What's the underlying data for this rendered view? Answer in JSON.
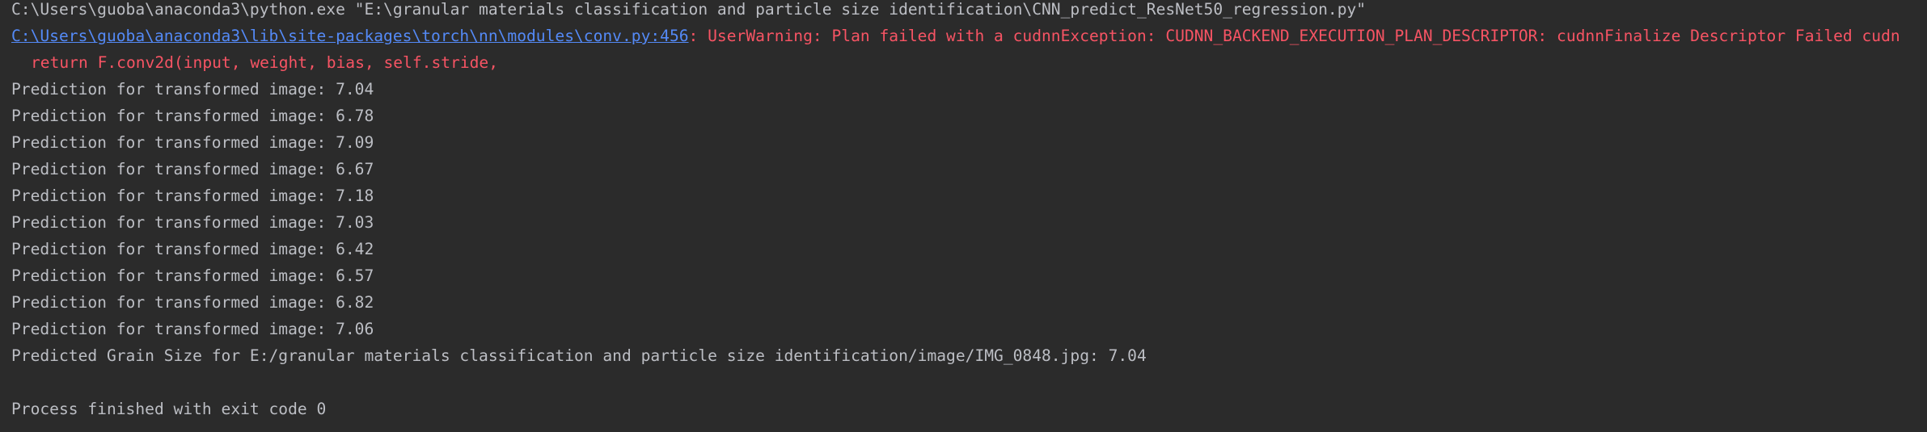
{
  "console": {
    "command": "C:\\Users\\guoba\\anaconda3\\python.exe \"E:\\granular materials classification and particle size identification\\CNN_predict_ResNet50_regression.py\"",
    "warning_link": "C:\\Users\\guoba\\anaconda3\\lib\\site-packages\\torch\\nn\\modules\\conv.py:456",
    "warning_message": ": UserWarning: Plan failed with a cudnnException: CUDNN_BACKEND_EXECUTION_PLAN_DESCRIPTOR: cudnnFinalize Descriptor Failed cudn",
    "warning_code": "return F.conv2d(input, weight, bias, self.stride,",
    "predictions": [
      "Prediction for transformed image: 7.04",
      "Prediction for transformed image: 6.78",
      "Prediction for transformed image: 7.09",
      "Prediction for transformed image: 6.67",
      "Prediction for transformed image: 7.18",
      "Prediction for transformed image: 7.03",
      "Prediction for transformed image: 6.42",
      "Prediction for transformed image: 6.57",
      "Prediction for transformed image: 6.82",
      "Prediction for transformed image: 7.06"
    ],
    "summary": "Predicted Grain Size for E:/granular materials classification and particle size identification/image/IMG_0848.jpg: 7.04",
    "exit_message": "Process finished with exit code 0"
  },
  "colors": {
    "background": "#2b2b2b",
    "text": "#bcbec4",
    "link": "#548af7",
    "warning": "#f75464"
  }
}
